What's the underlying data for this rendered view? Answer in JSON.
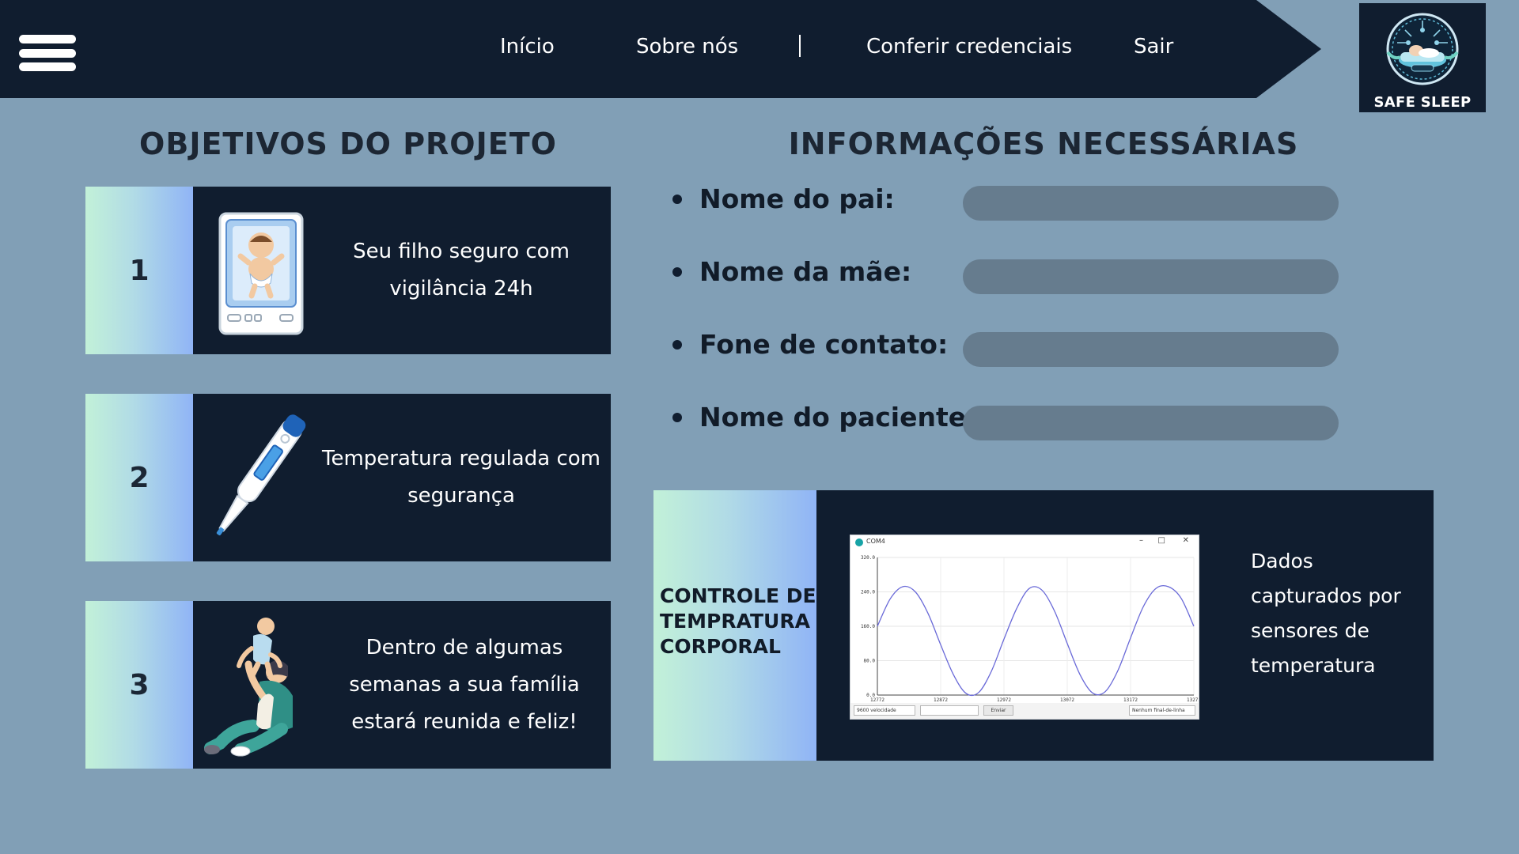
{
  "header": {
    "nav": [
      {
        "label": "Início"
      },
      {
        "label": "Sobre nós"
      },
      {
        "label": "Conferir credenciais"
      },
      {
        "label": "Sair"
      }
    ],
    "logo_text": "SAFE SLEEP"
  },
  "objectives": {
    "title": "OBJETIVOS DO PROJETO",
    "cards": [
      {
        "number": "1",
        "text": "Seu filho seguro com vigilância 24h",
        "icon": "baby-incubator-icon"
      },
      {
        "number": "2",
        "text": "Temperatura regulada com segurança",
        "icon": "thermometer-icon"
      },
      {
        "number": "3",
        "text": "Dentro de algumas semanas a sua família estará reunida e feliz!",
        "icon": "family-playing-icon"
      }
    ]
  },
  "info": {
    "title": "INFORMAÇÕES NECESSÁRIAS",
    "fields": [
      {
        "label": "Nome do pai:",
        "value": ""
      },
      {
        "label": "Nome da mãe:",
        "value": ""
      },
      {
        "label": "Fone de contato:",
        "value": ""
      },
      {
        "label": "Nome do paciente:",
        "value": ""
      }
    ]
  },
  "temperature": {
    "title": "CONTROLE DE TEMPRATURA CORPORAL",
    "description": "Dados capturados por sensores de temperatura",
    "plotter": {
      "window_title": "COM4",
      "baud": "9600 velocidade",
      "send_label": "Enviar",
      "line_ending": "Nenhum final-de-linha",
      "y_ticks": [
        "320.0",
        "240.0",
        "160.0",
        "80.0",
        "0.0"
      ],
      "x_ticks": [
        "12772",
        "12872",
        "12972",
        "13072",
        "13172",
        "13272"
      ]
    }
  },
  "colors": {
    "background": "#819fb6",
    "navy": "#101d2f",
    "input": "#667c8e",
    "plot_line": "#6a6ad8"
  },
  "chart_data": {
    "type": "line",
    "title": "",
    "xlabel": "",
    "ylabel": "",
    "xlim": [
      12772,
      13272
    ],
    "ylim": [
      0,
      320
    ],
    "series": [
      {
        "x": [
          12772,
          12792,
          12812,
          12832,
          12852,
          12872,
          12892,
          12912,
          12932,
          12952,
          12972,
          12992,
          13012,
          13032,
          13052,
          13072,
          13092,
          13112,
          13132,
          13152,
          13172,
          13192,
          13212,
          13232,
          13252,
          13272
        ],
        "values": [
          160,
          223,
          252,
          240,
          190,
          117,
          48,
          4,
          6,
          55,
          130,
          201,
          248,
          244,
          195,
          120,
          48,
          5,
          8,
          57,
          133,
          205,
          248,
          252,
          225,
          160
        ]
      }
    ],
    "grid": true
  }
}
